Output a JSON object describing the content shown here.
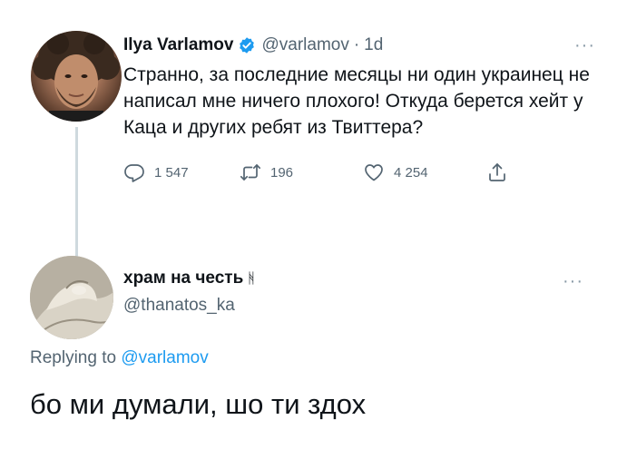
{
  "tweet": {
    "author_name": "Ilya Varlamov",
    "handle": "@varlamov",
    "separator": "·",
    "time": "1d",
    "more_icon": "more-dots-icon",
    "text": "Странно, за последние месяцы ни один украинец не написал мне ничего плохого! Откуда берется хейт у Каца и других ребят из Твиттера?",
    "replies": "1 547",
    "retweets": "196",
    "likes": "4 254"
  },
  "reply": {
    "author_name": "храм на честь",
    "name_symbol": "ᚻ",
    "handle": "@thanatos_ka",
    "replying_prefix": "Replying to",
    "replying_to": "@varlamov",
    "text": "бо ми думали, шо ти здох"
  },
  "colors": {
    "text": "#0f1419",
    "secondary": "#536471",
    "accent": "#1d9bf0",
    "thread_line": "#cfd9de"
  }
}
